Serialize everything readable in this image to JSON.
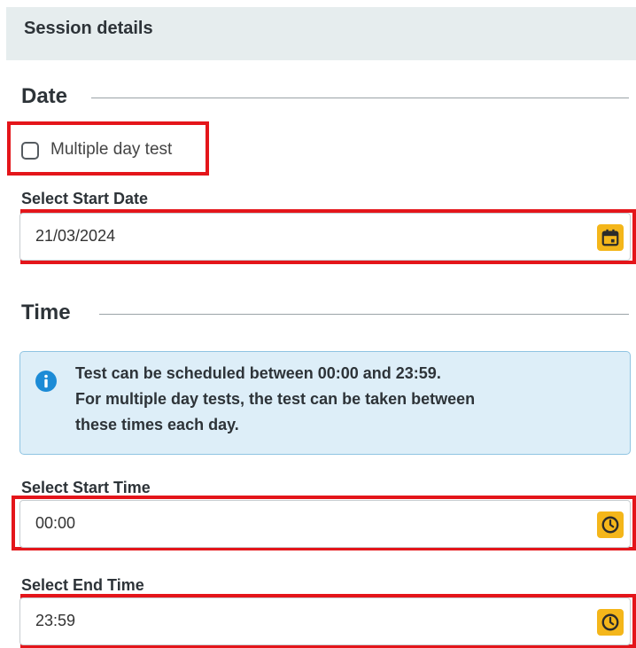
{
  "header": {
    "title": "Session details"
  },
  "date_section": {
    "title": "Date",
    "multiple_day_label": "Multiple day test",
    "multiple_day_checked": false,
    "start_date_label": "Select Start Date",
    "start_date_value": "21/03/2024",
    "start_date_icon": "calendar-icon"
  },
  "time_section": {
    "title": "Time",
    "info_icon": "info-icon",
    "info_lines": [
      "Test can be scheduled between 00:00 and 23:59.",
      "For multiple day tests, the test can be taken between",
      "these times each day."
    ],
    "start_time_label": "Select Start Time",
    "start_time_value": "00:00",
    "end_time_label": "Select End Time",
    "end_time_value": "23:59",
    "time_icon": "clock-icon"
  },
  "colors": {
    "header_bg": "#e6edee",
    "accent": "#f4b61a",
    "highlight": "#e4151a",
    "info_bg": "#ddeef8",
    "info_border": "#8fc4e2",
    "info_icon": "#1c8bd6"
  }
}
